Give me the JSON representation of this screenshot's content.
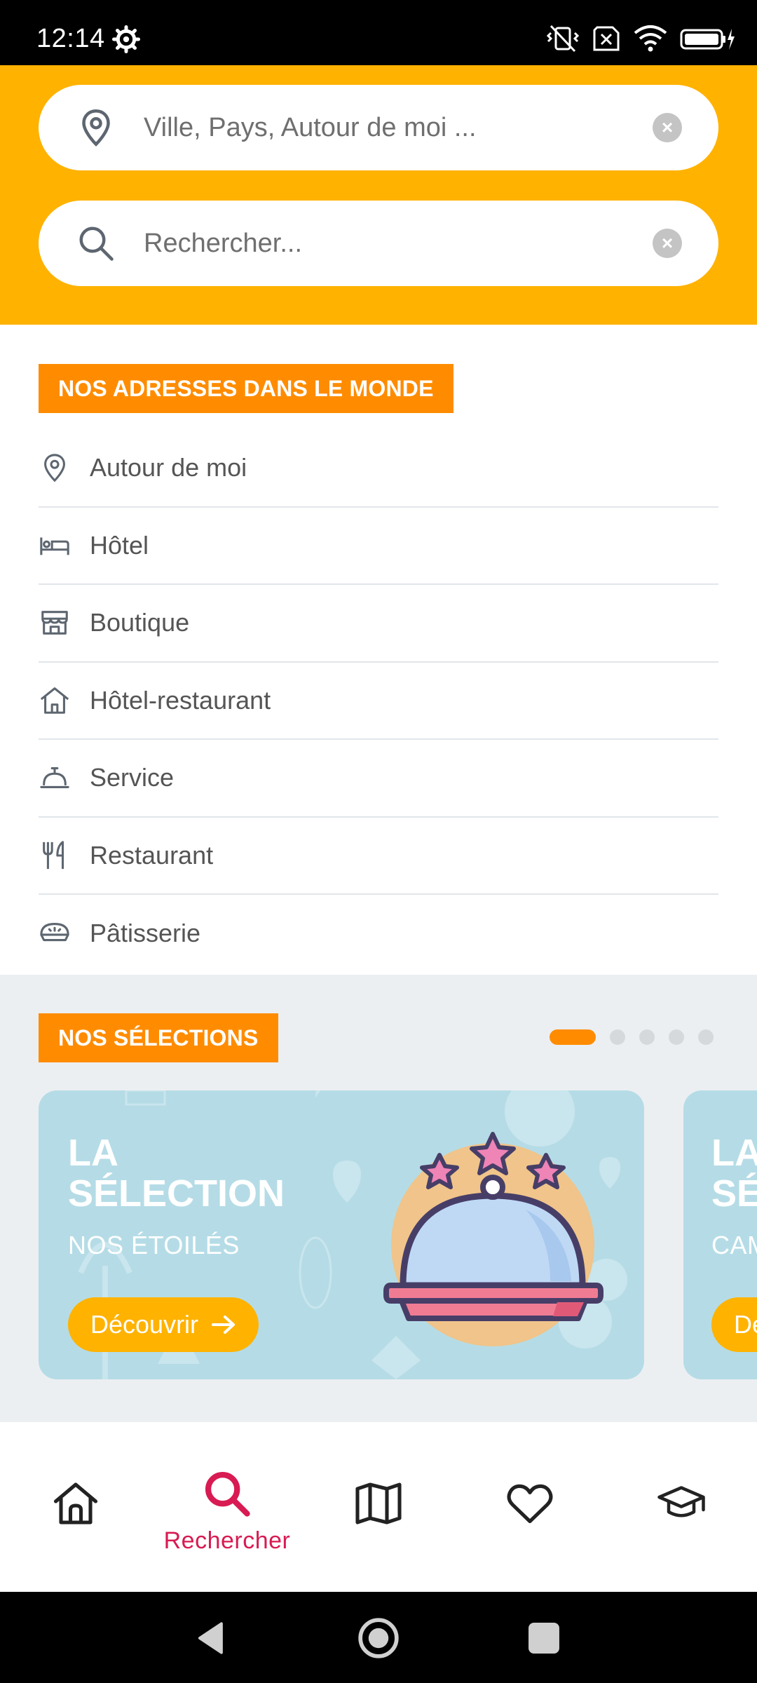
{
  "status_bar": {
    "time": "12:14",
    "icons": [
      "gear-icon",
      "muted-vibrate-icon",
      "no-sim-icon",
      "wifi-icon",
      "battery-charging-icon"
    ]
  },
  "search": {
    "location_placeholder": "Ville, Pays, Autour de moi ...",
    "query_placeholder": "Rechercher...",
    "clear_glyph": "×"
  },
  "addresses": {
    "title": "NOS ADRESSES DANS LE MONDE",
    "items": [
      {
        "label": "Autour de moi",
        "icon": "location-pin-icon"
      },
      {
        "label": "Hôtel",
        "icon": "bed-icon"
      },
      {
        "label": "Boutique",
        "icon": "store-icon"
      },
      {
        "label": "Hôtel-restaurant",
        "icon": "house-icon"
      },
      {
        "label": "Service",
        "icon": "service-bell-icon"
      },
      {
        "label": "Restaurant",
        "icon": "fork-knife-icon"
      },
      {
        "label": "Pâtisserie",
        "icon": "pie-icon"
      }
    ]
  },
  "selections": {
    "title": "NOS SÉLECTIONS",
    "cards": [
      {
        "title_line1": "LA",
        "title_line2": "SÉLECTION",
        "subtitle": "NOS ÉTOILÉS",
        "button": "Découvrir"
      },
      {
        "title_line1": "LA",
        "title_line2": "SÉ",
        "subtitle": "CAM",
        "button": "Dé"
      }
    ],
    "pager": {
      "count": 5,
      "active": 1
    }
  },
  "bottom_nav": {
    "items": [
      {
        "name": "home",
        "icon": "home-icon",
        "label": ""
      },
      {
        "name": "search",
        "icon": "search-icon",
        "label": "Rechercher"
      },
      {
        "name": "map",
        "icon": "map-icon",
        "label": ""
      },
      {
        "name": "favorites",
        "icon": "heart-icon",
        "label": ""
      },
      {
        "name": "academy",
        "icon": "graduation-cap-icon",
        "label": ""
      }
    ],
    "active_color": "#D81B52"
  },
  "colors": {
    "header": "#FFB200",
    "label": "#FF8C00",
    "card": "#B5DCE6"
  }
}
